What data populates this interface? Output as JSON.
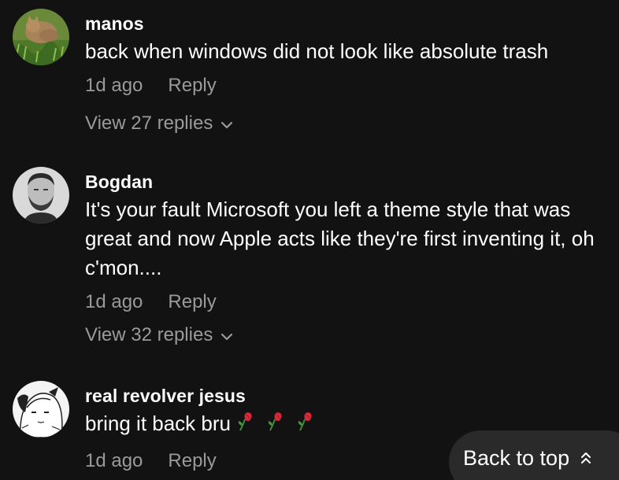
{
  "comments": [
    {
      "username": "manos",
      "text": "back when windows did not look like absolute trash",
      "time": "1d ago",
      "reply_label": "Reply",
      "view_replies": "View 27 replies",
      "avatar": "cat-in-grass-photo"
    },
    {
      "username": "Bogdan",
      "text": "It's your fault Microsoft you left a theme style that was great and now Apple acts like they're first inventing it, oh c'mon....",
      "time": "1d ago",
      "reply_label": "Reply",
      "view_replies": "View 32 replies",
      "avatar": "man-portrait-photo"
    },
    {
      "username": "real revolver jesus",
      "text": "bring it back bru",
      "emojis": [
        "wilted-rose-icon",
        "wilted-rose-icon",
        "wilted-rose-icon"
      ],
      "time": "1d ago",
      "reply_label": "Reply",
      "avatar": "anime-sketch-drawing"
    }
  ],
  "back_to_top": {
    "label": "Back to top",
    "icon": "double-chevron-up-icon"
  },
  "colors": {
    "background": "#121212",
    "primary_text": "#ffffff",
    "secondary_text": "#9a9a9a",
    "button_bg": "#2a2a2a"
  }
}
